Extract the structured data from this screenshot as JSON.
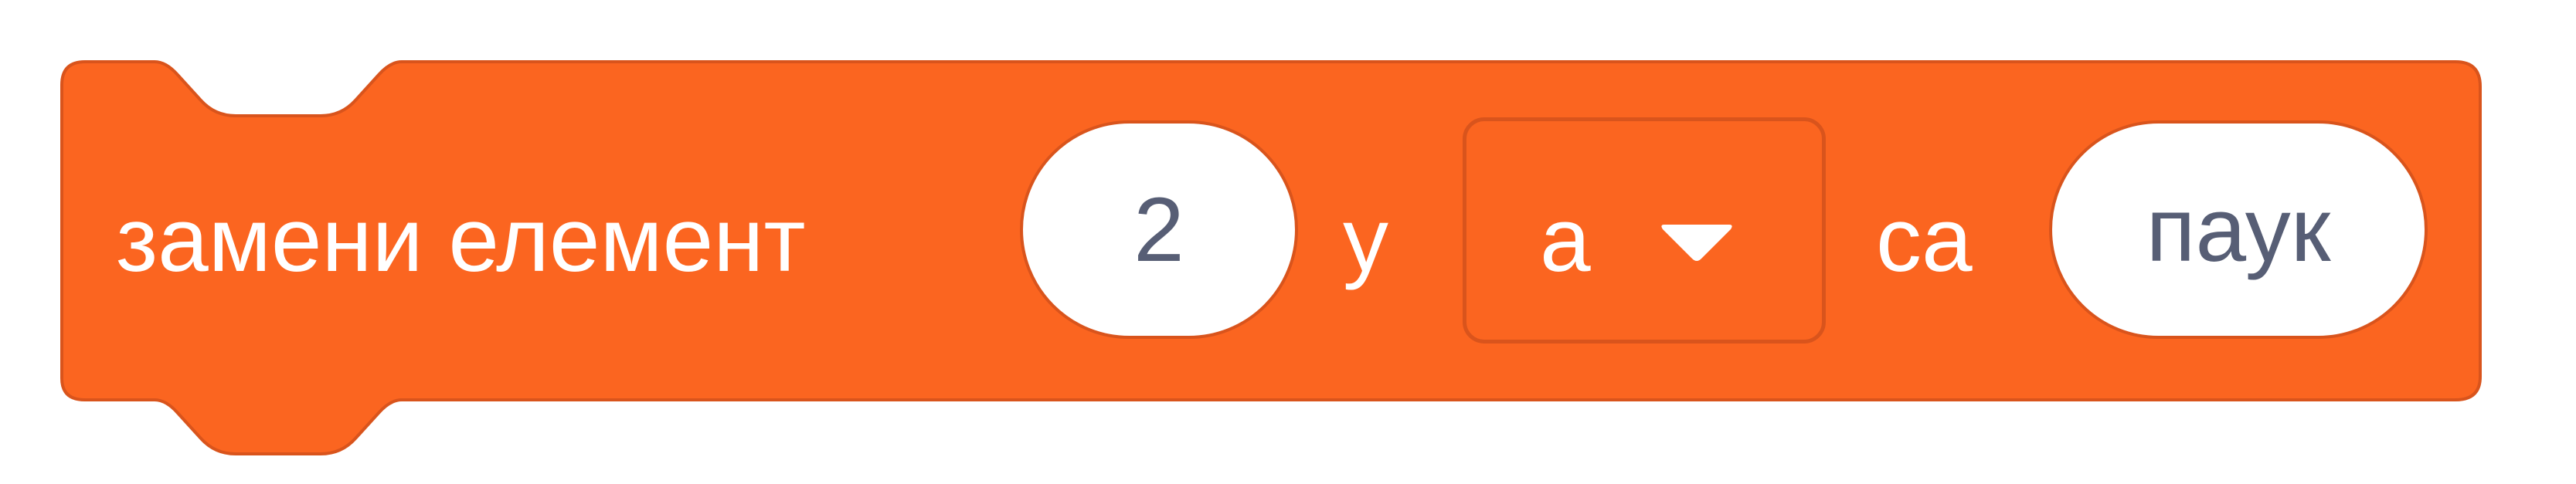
{
  "block": {
    "category_color": "#fb6520",
    "border_color": "#d9541c",
    "label_main": "замени елемент",
    "index_value": "2",
    "label_in": "у",
    "list_dropdown": {
      "selected": "а",
      "icon": "dropdown-arrow-icon"
    },
    "label_with": "са",
    "item_value": "паук"
  }
}
